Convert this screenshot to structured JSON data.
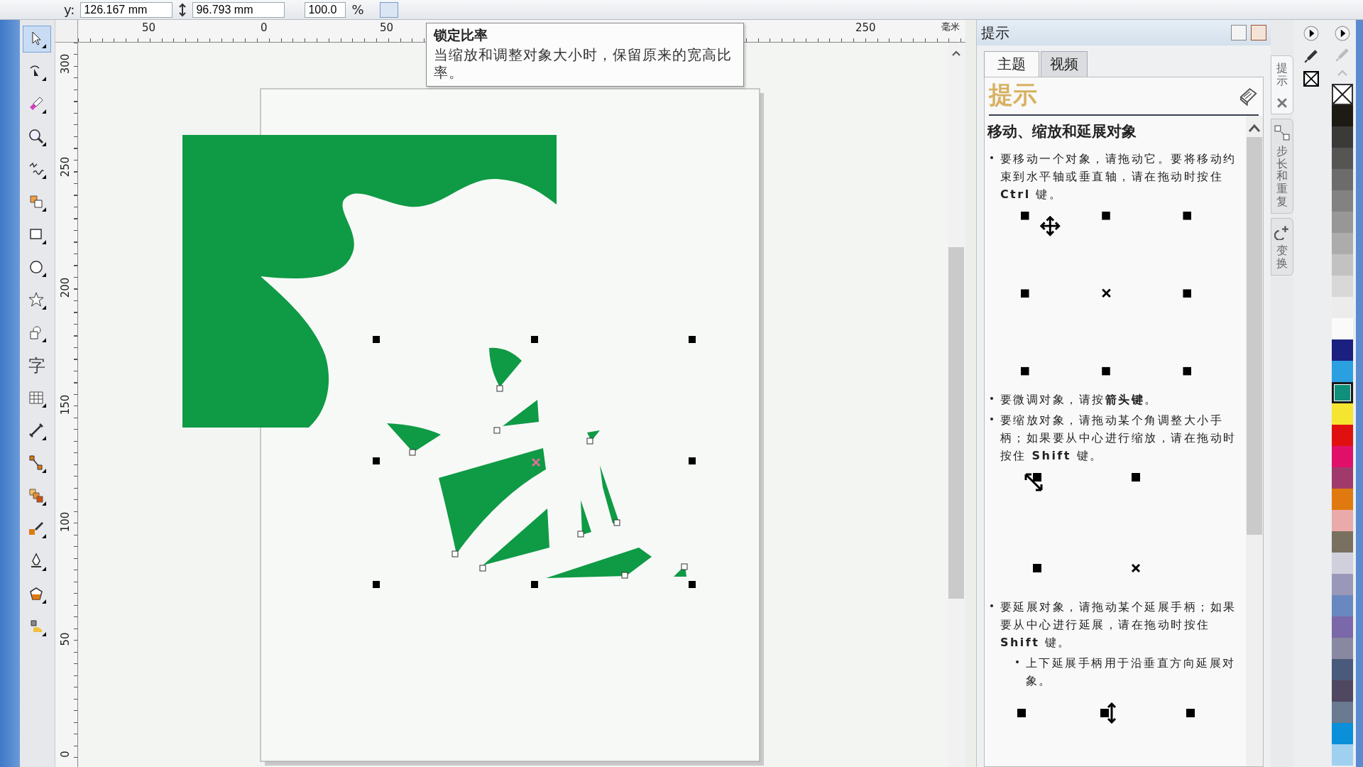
{
  "property_bar": {
    "y_label": "y:",
    "y_value": "126.167 mm",
    "height_value": "96.793 mm",
    "scale_value": "100.0",
    "scale_unit": "%"
  },
  "toolbox": [
    {
      "kind": "pointer",
      "selected": true
    },
    {
      "kind": "shape",
      "selected": false
    },
    {
      "kind": "smudge",
      "selected": false
    },
    {
      "kind": "zoom",
      "selected": false
    },
    {
      "kind": "freehand",
      "selected": false
    },
    {
      "kind": "smartfill",
      "selected": false
    },
    {
      "kind": "rectangle",
      "selected": false
    },
    {
      "kind": "ellipse",
      "selected": false
    },
    {
      "kind": "star",
      "selected": false
    },
    {
      "kind": "shapes",
      "selected": false
    },
    {
      "kind": "text",
      "label": "字",
      "selected": false
    },
    {
      "kind": "table",
      "selected": false
    },
    {
      "kind": "dimension",
      "selected": false
    },
    {
      "kind": "connector",
      "selected": false
    },
    {
      "kind": "blend",
      "selected": false
    },
    {
      "kind": "eyedropper",
      "selected": false
    },
    {
      "kind": "pen",
      "selected": false
    },
    {
      "kind": "fill",
      "selected": false
    },
    {
      "kind": "interactive",
      "selected": false
    }
  ],
  "ruler": {
    "top_labels": [
      "50",
      "0",
      "50",
      "250"
    ],
    "unit": "毫米",
    "left_labels": [
      "300",
      "250",
      "200",
      "150",
      "100",
      "50",
      "0"
    ]
  },
  "tooltip": {
    "title": "锁定比率",
    "text": "当缩放和调整对象大小时，保留原来的宽高比率。"
  },
  "docker": {
    "title": "提示",
    "tabs": [
      {
        "label": "主题",
        "selected": true
      },
      {
        "label": "视频",
        "selected": false
      }
    ],
    "header": "提示",
    "topic": "移动、缩放和延展对象",
    "content": [
      {
        "kind": "bullet",
        "text": "要移动一个对象，请拖动它。要将移动约束到水平轴或垂直轴，请在拖动时按住 **Ctrl** 键。"
      },
      {
        "kind": "move"
      },
      {
        "kind": "bullet",
        "text": "要微调对象，请按**箭头键**。"
      },
      {
        "kind": "bullet",
        "text": "要缩放对象，请拖动某个角调整大小手柄；如果要从中心进行缩放，请在拖动时按住 **Shift** 键。"
      },
      {
        "kind": "scale"
      },
      {
        "kind": "bullet",
        "text": "要延展对象，请拖动某个延展手柄；如果要从中心进行延展，请在拖动时按住 **Shift** 键。",
        "children": [
          {
            "text": "上下延展手柄用于沿垂直方向延展对象。"
          }
        ]
      },
      {
        "kind": "stretch"
      }
    ]
  },
  "side_tabs": [
    {
      "label": "提示",
      "selected": true
    },
    {
      "label": "步长和重复",
      "selected": false
    },
    {
      "label": "变换",
      "selected": false
    }
  ],
  "palette": [
    {
      "color": "#1e1a14",
      "selected": false
    },
    {
      "color": "#3a3a38",
      "selected": false
    },
    {
      "color": "#555654",
      "selected": false
    },
    {
      "color": "#6c6c6c",
      "selected": false
    },
    {
      "color": "#828282",
      "selected": false
    },
    {
      "color": "#979797",
      "selected": false
    },
    {
      "color": "#acacac",
      "selected": false
    },
    {
      "color": "#c2c2c2",
      "selected": false
    },
    {
      "color": "#d8d8d8",
      "selected": false
    },
    {
      "color": "#ececec",
      "selected": false
    },
    {
      "color": "#fafafa",
      "selected": false
    },
    {
      "color": "#1a2080",
      "selected": false
    },
    {
      "color": "#2aa0e0",
      "selected": false
    },
    {
      "color": "#10907a",
      "selected": true
    },
    {
      "color": "#f5e530",
      "selected": false
    },
    {
      "color": "#e01010",
      "selected": false
    },
    {
      "color": "#e0106a",
      "selected": false
    },
    {
      "color": "#a03a6a",
      "selected": false
    },
    {
      "color": "#e07a10",
      "selected": false
    },
    {
      "color": "#eaaaaa",
      "selected": false
    },
    {
      "color": "#7a7060",
      "selected": false
    },
    {
      "color": "#d0d0dc",
      "selected": false
    },
    {
      "color": "#9a98b8",
      "selected": false
    },
    {
      "color": "#6a88c0",
      "selected": false
    },
    {
      "color": "#7a68a8",
      "selected": false
    },
    {
      "color": "#8888a0",
      "selected": false
    },
    {
      "color": "#4a5a7a",
      "selected": false
    },
    {
      "color": "#504860",
      "selected": false
    },
    {
      "color": "#6a7a90",
      "selected": false
    },
    {
      "color": "#0a90d8",
      "selected": false
    },
    {
      "color": "#a0d0f0",
      "selected": false
    }
  ]
}
